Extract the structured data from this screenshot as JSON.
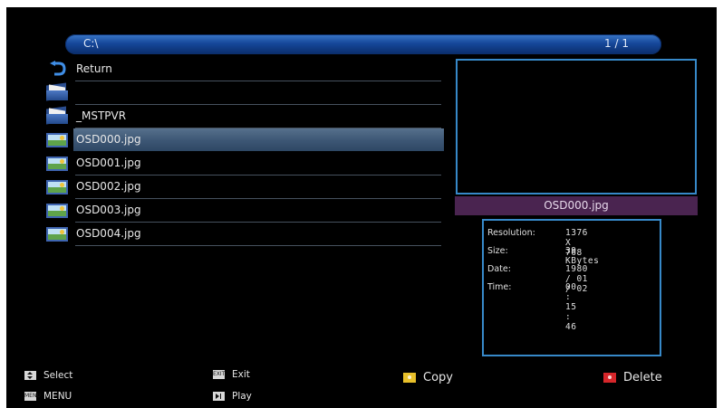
{
  "pathbar": {
    "path": "C:\\",
    "page": "1 / 1"
  },
  "files": [
    {
      "name": "Return",
      "icon": "return-icon",
      "selected": false
    },
    {
      "name": "",
      "icon": "folder-icon",
      "selected": false
    },
    {
      "name": "_MSTPVR",
      "icon": "folder-icon",
      "selected": false
    },
    {
      "name": "OSD000.jpg",
      "icon": "jpg-file-icon",
      "selected": true
    },
    {
      "name": "OSD001.jpg",
      "icon": "jpg-file-icon",
      "selected": false
    },
    {
      "name": "OSD002.jpg",
      "icon": "jpg-file-icon",
      "selected": false
    },
    {
      "name": "OSD003.jpg",
      "icon": "jpg-file-icon",
      "selected": false
    },
    {
      "name": "OSD004.jpg",
      "icon": "jpg-file-icon",
      "selected": false
    }
  ],
  "preview": {
    "filename": "OSD000.jpg"
  },
  "info": {
    "resolution_label": "Resolution:",
    "resolution": "1376 X 768",
    "size_label": "Size:",
    "size": "39 KBytes",
    "date_label": "Date:",
    "date": "1980 / 01 / 02",
    "time_label": "Time:",
    "time": "00 : 15 : 46"
  },
  "footer": {
    "select": "Select",
    "menu_key": "MENU",
    "menu": "MENU",
    "exit_key": "EXIT",
    "exit": "Exit",
    "play": "Play",
    "copy": "Copy",
    "delete": "Delete"
  },
  "colors": {
    "copy_button": "#e8c02a",
    "delete_button": "#d6262a",
    "highlight": "#4a6584",
    "border": "#3789c9",
    "name_bar": "#4a2450"
  }
}
